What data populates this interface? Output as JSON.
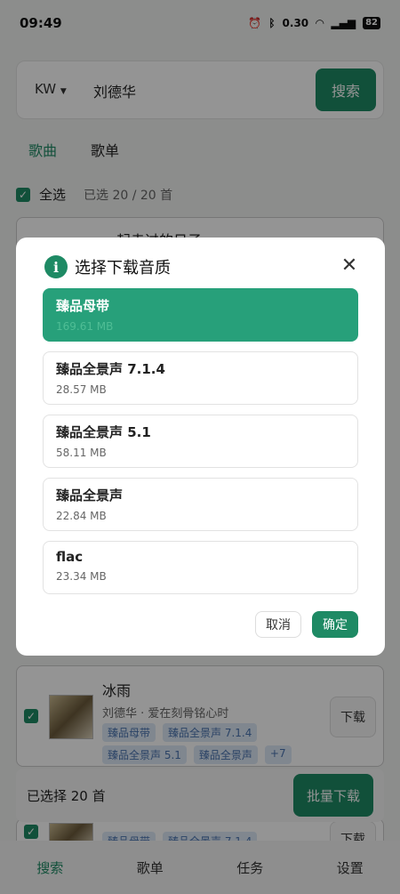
{
  "status_bar": {
    "time": "09:49",
    "speed": "0.30",
    "speed_unit": "KB/S",
    "battery": "82"
  },
  "search": {
    "source": "KW",
    "query": "刘德华",
    "button": "搜索"
  },
  "tabs": [
    "歌曲",
    "歌单"
  ],
  "selection": {
    "select_all": "全选",
    "count": "已选 20 / 20 首"
  },
  "songs": {
    "top_title": "一起走过的日子",
    "main": {
      "title": "冰雨",
      "subtitle": "刘德华 · 爱在刻骨铭心时",
      "tags": [
        "臻品母带",
        "臻品全景声 7.1.4",
        "臻品全景声 5.1",
        "臻品全景声",
        "+7"
      ],
      "download": "下载"
    },
    "peek_tags": [
      "臻品母带",
      "臻品全景声 7.1.4"
    ],
    "peek_download": "下载"
  },
  "batch": {
    "selected": "已选择 20 首",
    "button": "批量下载"
  },
  "bottom_nav": [
    "搜索",
    "歌单",
    "任务",
    "设置"
  ],
  "dialog": {
    "title": "选择下载音质",
    "options": [
      {
        "name": "臻品母带",
        "size": "169.61 MB"
      },
      {
        "name": "臻品全景声 7.1.4",
        "size": "28.57 MB"
      },
      {
        "name": "臻品全景声 5.1",
        "size": "58.11 MB"
      },
      {
        "name": "臻品全景声",
        "size": "22.84 MB"
      },
      {
        "name": "flac",
        "size": "23.34 MB"
      }
    ],
    "cancel": "取消",
    "confirm": "确定"
  },
  "colors": {
    "accent": "#1e8a64",
    "selected_option": "#27a07a",
    "tag_bg": "#dde9f7",
    "tag_text": "#4a74b0"
  }
}
